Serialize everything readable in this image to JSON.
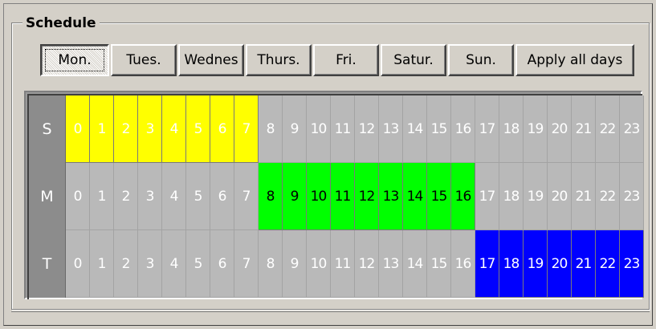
{
  "schedule": {
    "title": "Schedule",
    "buttons": [
      {
        "label": "Mon.",
        "active": true
      },
      {
        "label": "Tues.",
        "active": false
      },
      {
        "label": "Wednes",
        "active": false
      },
      {
        "label": "Thurs.",
        "active": false
      },
      {
        "label": "Fri.",
        "active": false
      },
      {
        "label": "Satur.",
        "active": false
      },
      {
        "label": "Sun.",
        "active": false
      },
      {
        "label": "Apply all days",
        "active": false
      }
    ],
    "rows": [
      {
        "label": "S",
        "color": "#ffff00",
        "text_on": "#ffffff",
        "active_hours": [
          0,
          1,
          2,
          3,
          4,
          5,
          6,
          7
        ]
      },
      {
        "label": "M",
        "color": "#00ff00",
        "text_on": "#000000",
        "active_hours": [
          8,
          9,
          10,
          11,
          12,
          13,
          14,
          15,
          16
        ]
      },
      {
        "label": "T",
        "color": "#0000ff",
        "text_on": "#ffffff",
        "active_hours": [
          17,
          18,
          19,
          20,
          21,
          22,
          23
        ]
      }
    ],
    "hours": [
      "0",
      "1",
      "2",
      "3",
      "4",
      "5",
      "6",
      "7",
      "8",
      "9",
      "10",
      "11",
      "12",
      "13",
      "14",
      "15",
      "16",
      "17",
      "18",
      "19",
      "20",
      "21",
      "22",
      "23"
    ],
    "colors": {
      "inactive_cell": "#b9b9b9",
      "row_label_bg": "#8c8c8c",
      "window_bg": "#d4d0c8"
    }
  }
}
